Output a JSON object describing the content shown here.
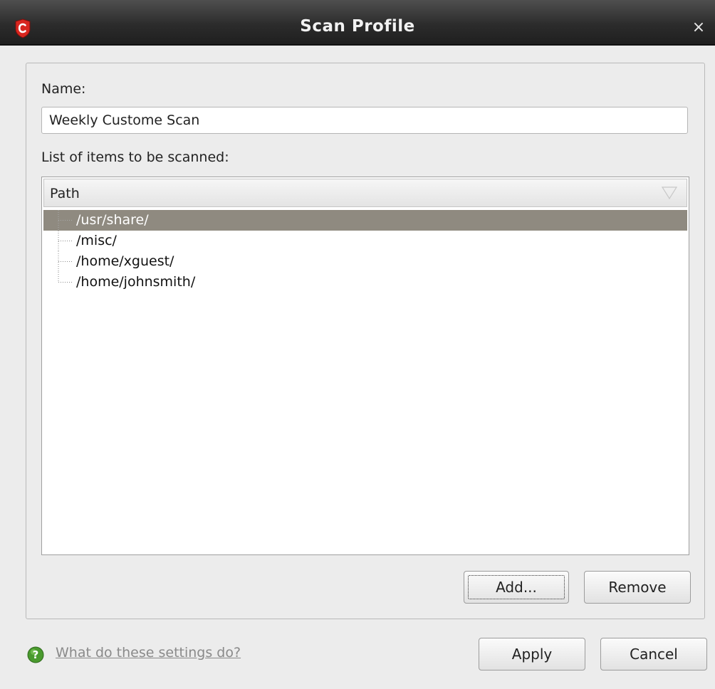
{
  "window": {
    "title": "Scan Profile",
    "close_glyph": "×"
  },
  "form": {
    "name_label": "Name:",
    "name_value": "Weekly Custome Scan",
    "list_label": "List of items to be scanned:"
  },
  "tree": {
    "column_header": "Path",
    "items": [
      {
        "path": "/usr/share/",
        "selected": true
      },
      {
        "path": "/misc/",
        "selected": false
      },
      {
        "path": "/home/xguest/",
        "selected": false
      },
      {
        "path": "/home/johnsmith/",
        "selected": false
      }
    ]
  },
  "buttons": {
    "add": "Add...",
    "remove": "Remove",
    "apply": "Apply",
    "cancel": "Cancel"
  },
  "help": {
    "link_text": "What do these settings do?"
  },
  "colors": {
    "selection": "#8f8a80",
    "titlebar": "#2c2c2c",
    "app_icon_red": "#d8261f",
    "help_icon_green": "#4a9a2e"
  },
  "icons": {
    "app": "comodo-shield-icon",
    "close": "close-icon",
    "sort": "sort-triangle-icon",
    "help": "help-question-icon"
  }
}
